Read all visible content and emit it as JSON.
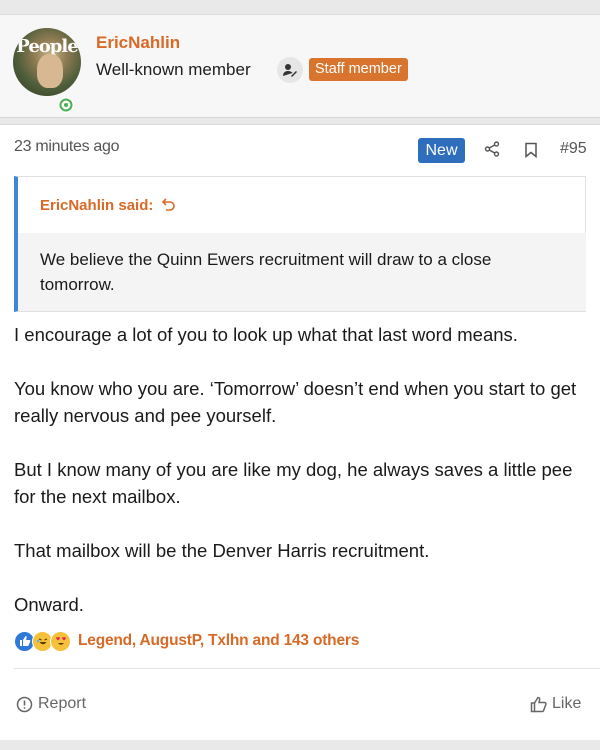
{
  "author": {
    "username": "EricNahlin",
    "user_title": "Well-known member",
    "staff_badge": "Staff member",
    "avatar_text": "People"
  },
  "post": {
    "time": "23 minutes ago",
    "new_badge": "New",
    "number": "#95",
    "quote": {
      "author_label": "EricNahlin said:",
      "text": "We believe the Quinn Ewers recruitment will draw to a close tomorrow."
    },
    "paragraphs": [
      "I encourage a lot of you to look up what that last word means.",
      "You know who you are. ‘Tomorrow’ doesn’t end when you start to get really nervous and pee yourself.",
      "But I know many of you are like my dog, he always saves a little pee for the next mailbox.",
      "That mailbox will be the Denver Harris recruitment.",
      "Onward."
    ],
    "reactions_text": "Legend, AugustP, Txlhn and 143 others"
  },
  "actions": {
    "report": "Report",
    "like": "Like"
  },
  "icons": {
    "share": "share-icon",
    "bookmark": "bookmark-icon",
    "report": "report-icon",
    "like": "thumbs-up-icon",
    "quote_jump": "jump-arrow-icon",
    "user_badge": "user-edit-icon",
    "online": "online-status-icon"
  },
  "colors": {
    "accent": "#d86a27",
    "staff_badge_bg": "#d9742e",
    "new_badge_bg": "#2f6dbd",
    "quote_border": "#3f87d4",
    "online_green": "#4caf50"
  }
}
